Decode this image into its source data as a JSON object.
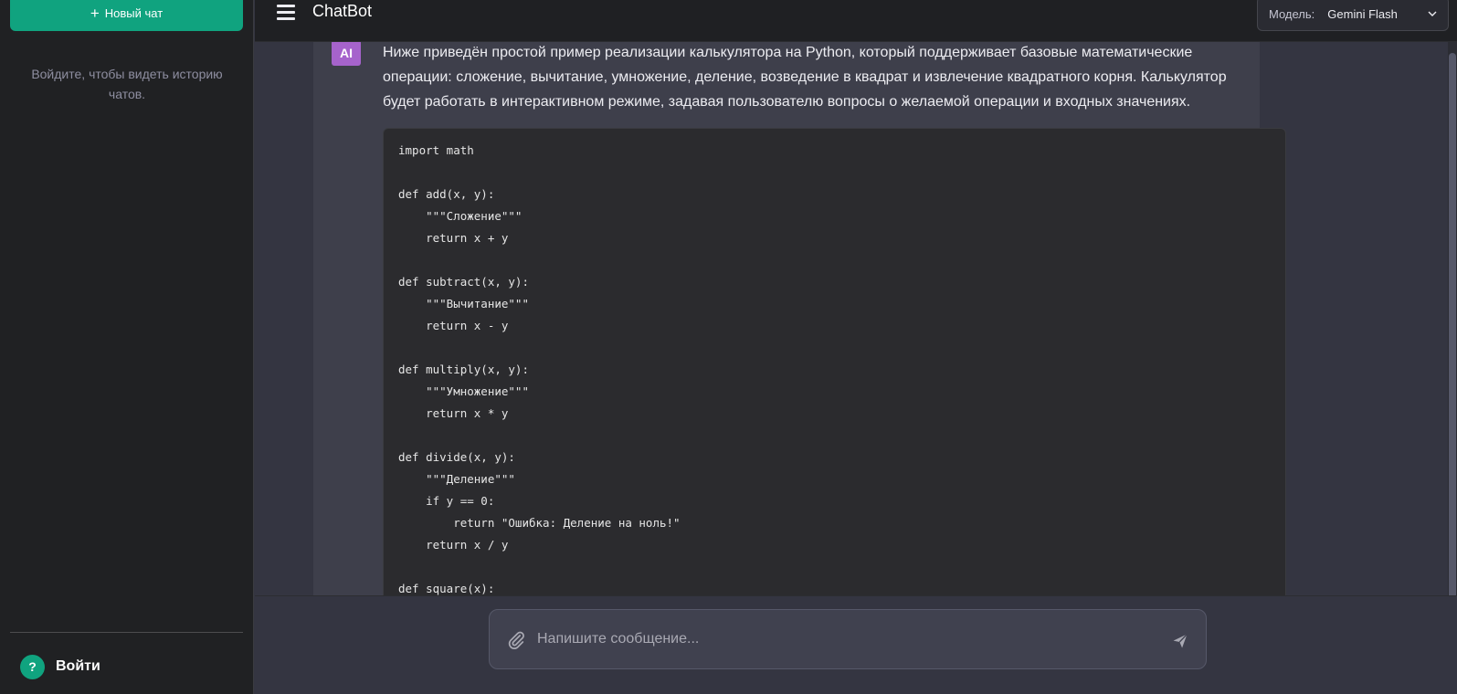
{
  "sidebar": {
    "new_chat_label": "Новый чат",
    "login_hint": "Войдите, чтобы видеть историю чатов.",
    "login_label": "Войти",
    "help_symbol": "?"
  },
  "header": {
    "title": "ChatBot",
    "model_label": "Модель:",
    "model_value": "Gemini Flash"
  },
  "chat": {
    "message": {
      "avatar": "AI",
      "text": "Ниже приведён простой пример реализации калькулятора на Python, который поддерживает базовые математические операции: сложение, вычитание, умножение, деление, возведение в квадрат и извлечение квадратного корня. Калькулятор будет работать в интерактивном режиме, задавая пользователю вопросы о желаемой операции и входных значениях.",
      "code": "import math\n\ndef add(x, y):\n    \"\"\"Сложение\"\"\"\n    return x + y\n\ndef subtract(x, y):\n    \"\"\"Вычитание\"\"\"\n    return x - y\n\ndef multiply(x, y):\n    \"\"\"Умножение\"\"\"\n    return x * y\n\ndef divide(x, y):\n    \"\"\"Деление\"\"\"\n    if y == 0:\n        return \"Ошибка: Деление на ноль!\"\n    return x / y\n\ndef square(x):"
    }
  },
  "composer": {
    "placeholder": "Напишите сообщение..."
  },
  "colors": {
    "accent": "#10a37f",
    "ai_avatar": "#a663cc",
    "sidebar_bg": "#202123",
    "chat_bg": "#343541"
  },
  "icons": [
    "plus-icon",
    "help-icon",
    "menu-icon",
    "chevron-down-icon",
    "attach-icon",
    "send-icon"
  ]
}
